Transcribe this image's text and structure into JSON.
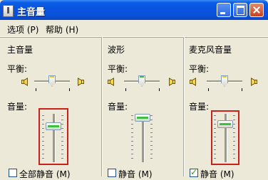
{
  "window": {
    "title": "主音量",
    "icon": "volume-app-icon",
    "buttons": [
      "minimize-icon",
      "maximize-icon",
      "close-icon"
    ]
  },
  "menu": {
    "options": "选项 (P)",
    "help": "帮助 (H)"
  },
  "columns": [
    {
      "title": "主音量",
      "balance_label": "平衡:",
      "volume_label": "音量:",
      "mute_label": "全部静音 (M)",
      "mute_checked": false,
      "balance_thumb": "yellow",
      "highlighted": true
    },
    {
      "title": "波形",
      "balance_label": "平衡:",
      "volume_label": "音量:",
      "mute_label": "静音 (M)",
      "mute_checked": false,
      "balance_thumb": "green",
      "highlighted": false
    },
    {
      "title": "麦克风音量",
      "balance_label": "平衡:",
      "volume_label": "音量:",
      "mute_label": "静音 (M)",
      "mute_checked": true,
      "balance_thumb": "yellow",
      "highlighted": true
    }
  ],
  "colors": {
    "highlight_border": "#c8201d",
    "titlebar": "#0a52d8",
    "window_bg": "#ece9d8"
  }
}
